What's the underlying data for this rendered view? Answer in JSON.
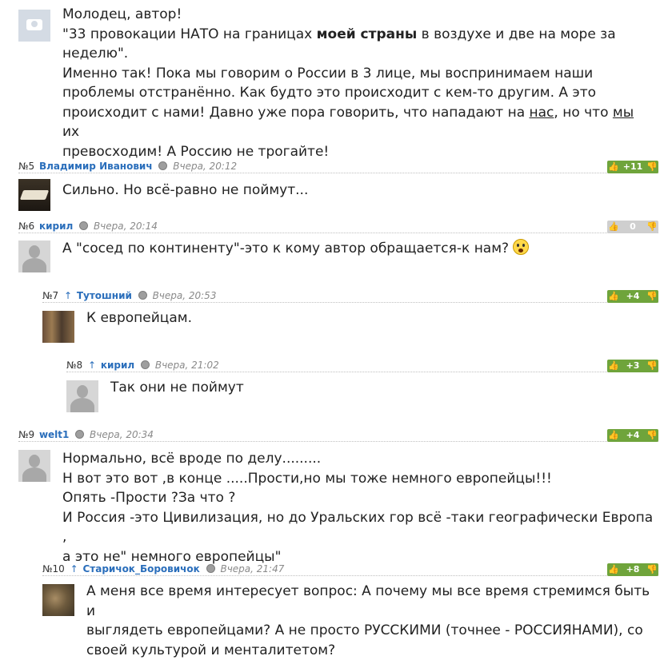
{
  "comments": [
    {
      "num": "",
      "author": "",
      "time": "",
      "votes": "",
      "avatar": "camera-avatar",
      "lines": [
        "Молодец, автор!",
        "\"33 провокации НАТО на границах ||моей страны|| в воздухе и две на море за",
        "неделю\".",
        "Именно так! Пока мы говорим о России в 3 лице, мы воспринимаем наши",
        "проблемы отстранённо. Как будто это происходит с кем-то другим. А это",
        "происходит с нами! Давно уже пора говорить, что нападают на __нас__, но что __мы__ их",
        "превосходим! А Россию не трогайте!"
      ]
    },
    {
      "num": "№5",
      "author": "Владимир Иванович",
      "time": "Вчера, 20:12",
      "votes": "+11",
      "avatar": "book-avatar",
      "lines": [
        "Сильно. Но всё-равно не поймут..."
      ]
    },
    {
      "num": "№6",
      "author": "кирил",
      "time": "Вчера, 20:14",
      "votes": "0",
      "avatar": "default-avatar",
      "lines": [
        "А \"сосед по континенту\"-это к кому автор обращается-к нам?"
      ]
    },
    {
      "num": "№7",
      "author": "Тутошний",
      "time": "Вчера, 20:53",
      "votes": "+4",
      "avatar": "cats-avatar",
      "lines": [
        "К европейцам."
      ]
    },
    {
      "num": "№8",
      "author": "кирил",
      "time": "Вчера, 21:02",
      "votes": "+3",
      "avatar": "default-avatar",
      "lines": [
        "Так они не поймут"
      ]
    },
    {
      "num": "№9",
      "author": "welt1",
      "time": "Вчера, 20:34",
      "votes": "+4",
      "avatar": "default-avatar",
      "lines": [
        "Нормально, всё вроде по делу.........",
        "Н вот это вот ,в конце .....Прости,но мы тоже немного европейцы!!!",
        "Опять -Прости ?За что ?",
        "И Россия -это Цивилизация, но до Уральских гор всё -таки географически Европа ,",
        "а это не\" немного европейцы\""
      ]
    },
    {
      "num": "№10",
      "author": "Старичок_Боровичок",
      "time": "Вчера, 21:47",
      "votes": "+8",
      "avatar": "owl-avatar",
      "lines": [
        "А меня все время интересует вопрос: А почему мы все время стремимся быть и",
        "выглядеть европейцами? А не просто РУССКИМИ (точнее - РОССИЯНАМИ), со",
        "своей культурой и менталитетом?"
      ]
    }
  ],
  "reply_arrow": "↑",
  "colors": {
    "vote_positive": "#6fa43b",
    "vote_neutral": "#cfcfcf",
    "author_link": "#2a6ebb"
  }
}
